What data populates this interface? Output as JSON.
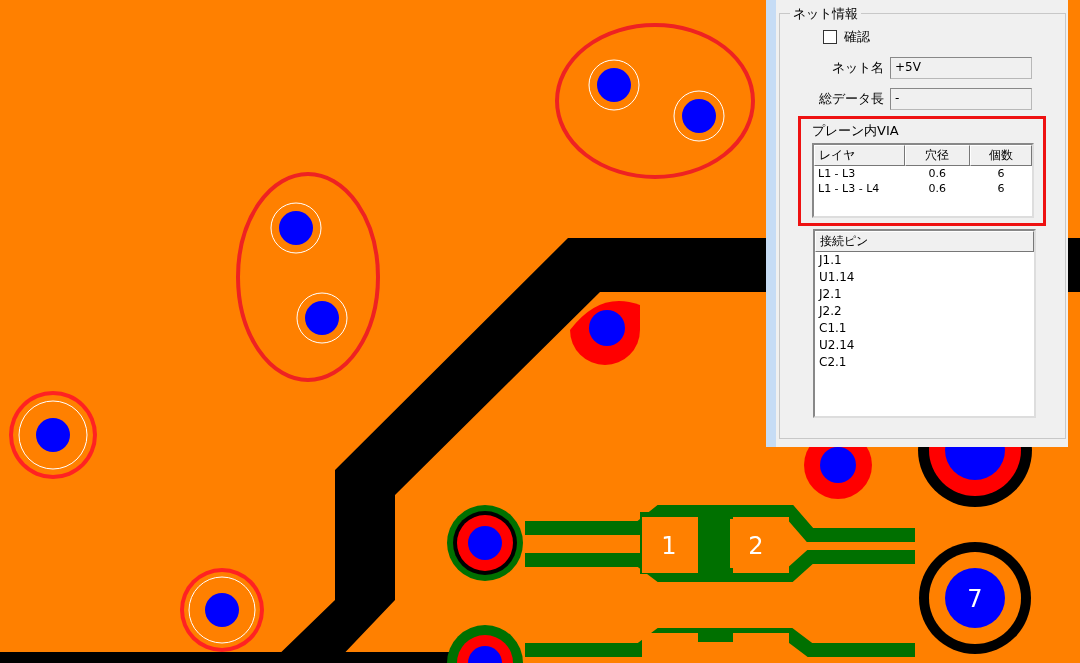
{
  "board": {
    "pad_labels": [
      {
        "text": "1"
      },
      {
        "text": "2"
      },
      {
        "text": "7"
      }
    ]
  },
  "panel": {
    "title": "ネット情報",
    "confirm": {
      "label": "確認",
      "checked": false
    },
    "fields": [
      {
        "label": "ネット名",
        "value": "+5V"
      },
      {
        "label": "総データ長",
        "value": "-"
      }
    ],
    "via_group": {
      "title": "プレーン内VIA",
      "columns": [
        "レイヤ",
        "穴径",
        "個数"
      ],
      "rows": [
        [
          "L1 - L3",
          "0.6",
          "6"
        ],
        [
          "L1 - L3 - L4",
          "0.6",
          "6"
        ]
      ]
    },
    "pins": {
      "column": "接続ピン",
      "items": [
        "J1.1",
        "U1.14",
        "J2.1",
        "J2.2",
        "C1.1",
        "U2.14",
        "C2.1"
      ]
    }
  }
}
